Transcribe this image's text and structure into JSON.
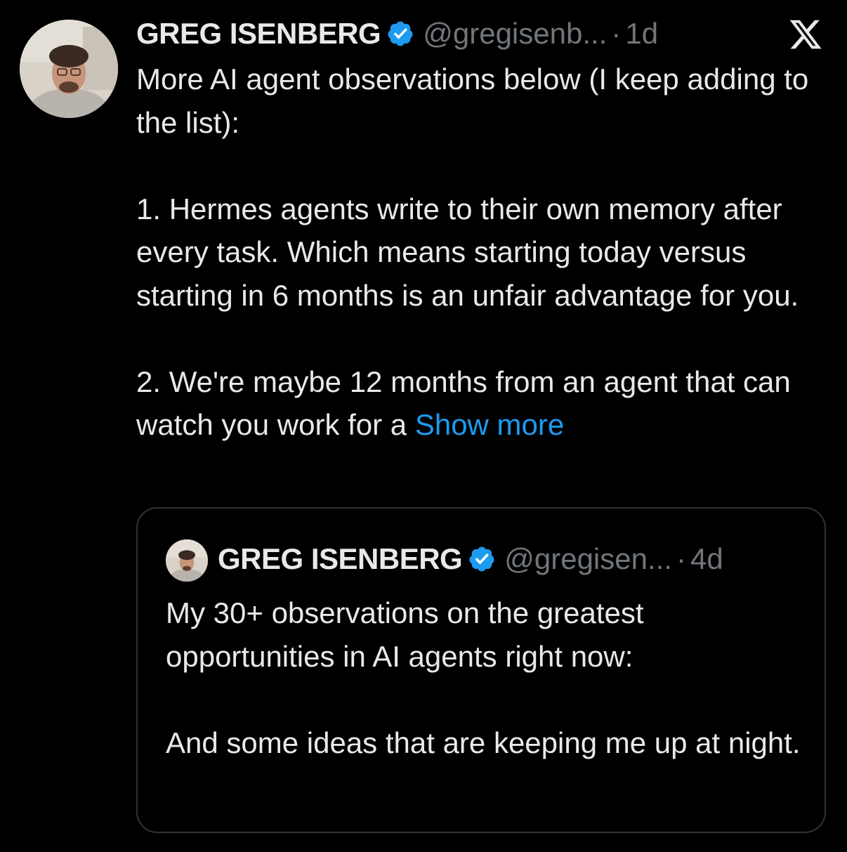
{
  "tweet": {
    "author": {
      "display_name": "GREG ISENBERG",
      "handle": "@gregisenb...",
      "separator": "·",
      "time": "1d",
      "verified": true,
      "avatar_icon": "profile-photo"
    },
    "platform_icon": "x-logo-icon",
    "text_lines": {
      "intro": "More AI agent observations below (I keep adding to the list):",
      "point1": "1. Hermes agents write to their own memory after every task. Which means starting today versus starting in 6 months is an unfair advantage for you.",
      "point2_prefix": "2. We're maybe 12 months from an agent that can watch you work for a ",
      "show_more": "Show more"
    },
    "quoted_tweet": {
      "author": {
        "display_name": "GREG ISENBERG",
        "handle": "@gregisen...",
        "separator": "·",
        "time": "4d",
        "verified": true
      },
      "text": {
        "line1": "My 30+ observations on the greatest opportunities in AI agents right now:",
        "line2": "And some ideas that are keeping me up at night."
      }
    }
  },
  "colors": {
    "background": "#000000",
    "text": "#e7e9ea",
    "secondary": "#71767b",
    "accent": "#1d9bf0",
    "border": "#2f3336"
  }
}
